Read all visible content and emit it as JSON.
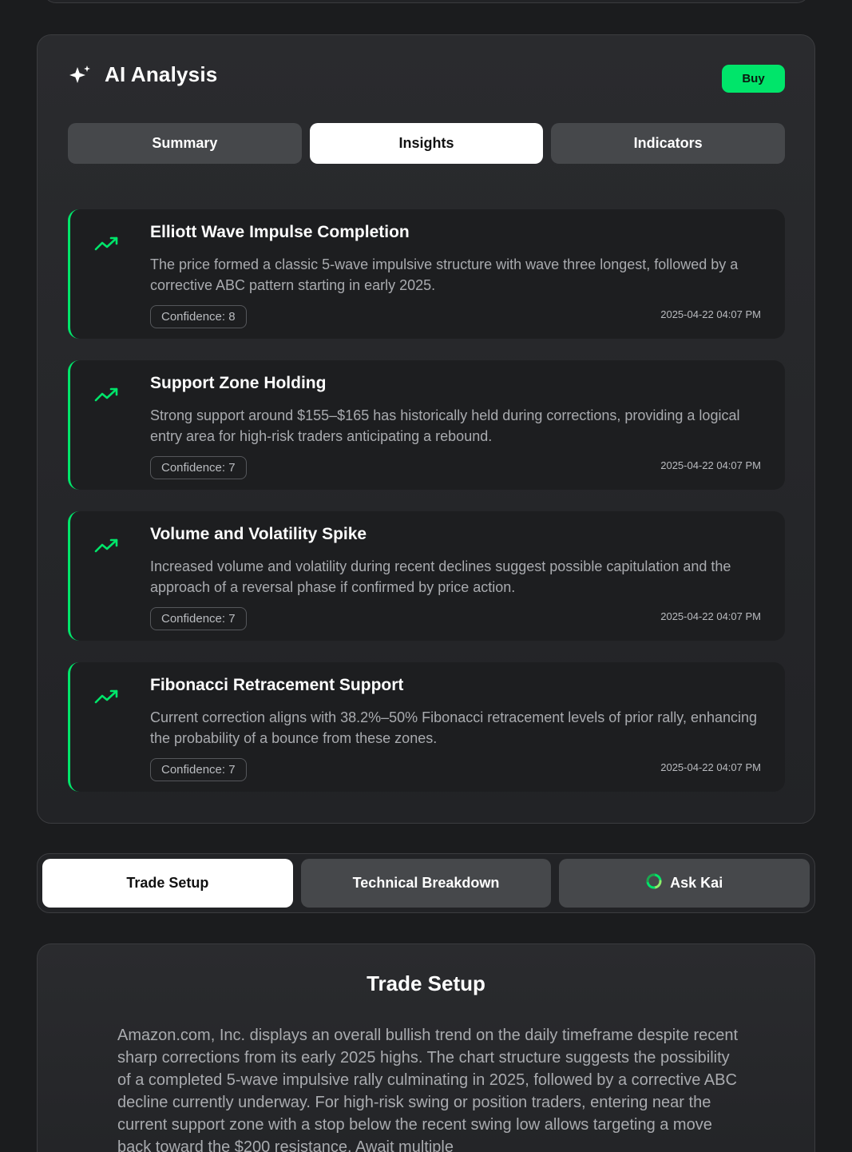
{
  "ai_analysis": {
    "title": "AI Analysis",
    "signal": "Buy",
    "tabs": [
      {
        "label": "Summary",
        "active": false
      },
      {
        "label": "Insights",
        "active": true
      },
      {
        "label": "Indicators",
        "active": false
      }
    ],
    "insights": [
      {
        "title": "Elliott Wave Impulse Completion",
        "description": "The price formed a classic 5-wave impulsive structure with wave three longest, followed by a corrective ABC pattern starting in early 2025.",
        "confidence": "Confidence: 8",
        "timestamp": "2025-04-22 04:07 PM",
        "icon": "trending-up-icon"
      },
      {
        "title": "Support Zone Holding",
        "description": "Strong support around $155–$165 has historically held during corrections, providing a logical entry area for high-risk traders anticipating a rebound.",
        "confidence": "Confidence: 7",
        "timestamp": "2025-04-22 04:07 PM",
        "icon": "trending-up-icon"
      },
      {
        "title": "Volume and Volatility Spike",
        "description": "Increased volume and volatility during recent declines suggest possible capitulation and the approach of a reversal phase if confirmed by price action.",
        "confidence": "Confidence: 7",
        "timestamp": "2025-04-22 04:07 PM",
        "icon": "trending-up-icon"
      },
      {
        "title": "Fibonacci Retracement Support",
        "description": "Current correction aligns with 38.2%–50% Fibonacci retracement levels of prior rally, enhancing the probability of a bounce from these zones.",
        "confidence": "Confidence: 7",
        "timestamp": "2025-04-22 04:07 PM",
        "icon": "trending-up-icon"
      }
    ]
  },
  "section_tabs": [
    {
      "label": "Trade Setup",
      "active": true
    },
    {
      "label": "Technical Breakdown",
      "active": false
    },
    {
      "label": "Ask Kai",
      "active": false,
      "icon": "kai-icon"
    }
  ],
  "trade_setup": {
    "title": "Trade Setup",
    "text": "Amazon.com, Inc. displays an overall bullish trend on the daily timeframe despite recent sharp corrections from its early 2025 highs. The chart structure suggests the possibility of a completed 5-wave impulsive rally culminating in 2025, followed by a corrective ABC decline currently underway. For high-risk swing or position traders, entering near the current support zone with a stop below the recent swing low allows targeting a move back toward the $200 resistance. Await multiple"
  },
  "colors": {
    "accent": "#00e56a",
    "background": "#1b1c1e",
    "card": "#222326",
    "tab_inactive": "#46484b"
  }
}
